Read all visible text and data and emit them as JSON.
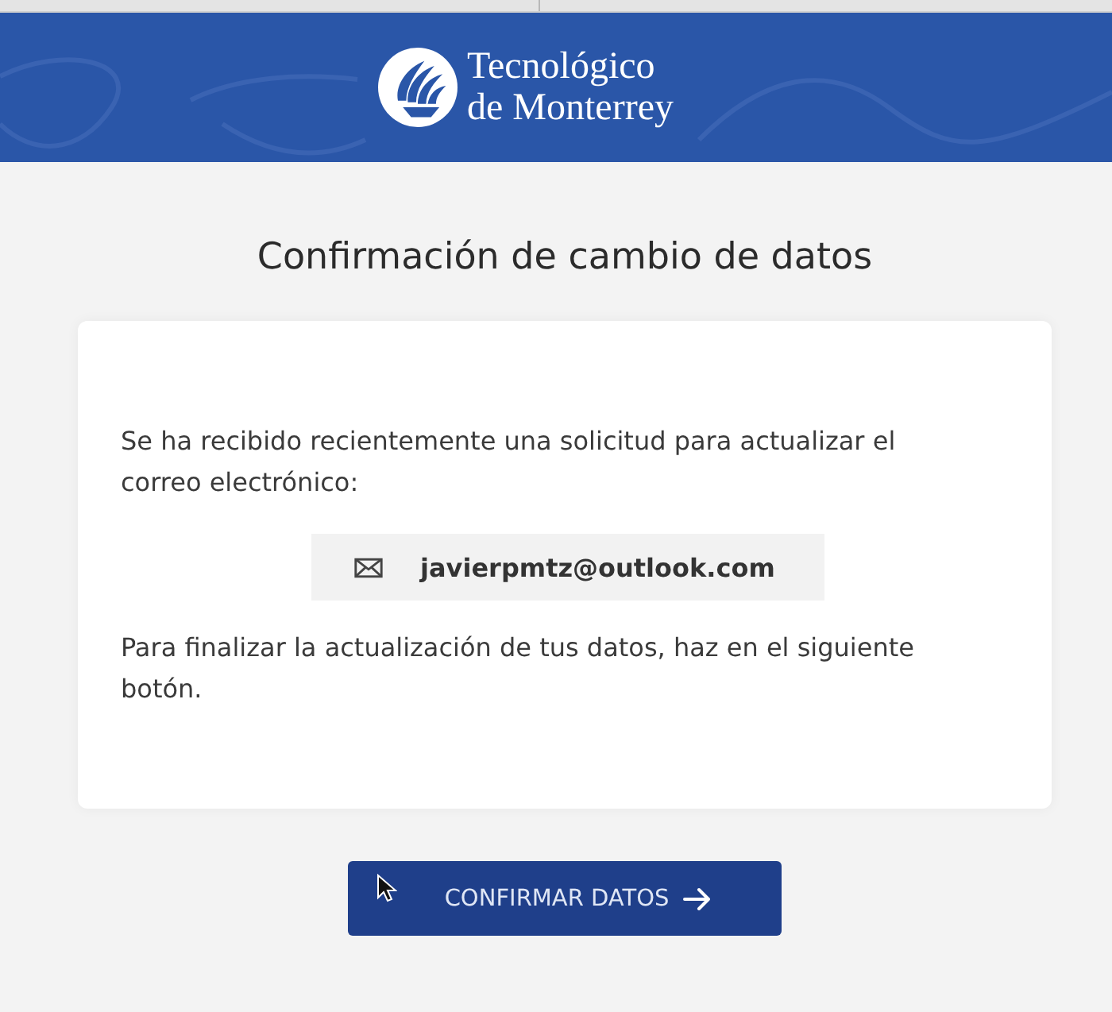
{
  "header": {
    "logo_text": [
      "Tecnológico",
      "de Monterrey"
    ]
  },
  "title": "Confirmación de cambio de datos",
  "card": {
    "intro": "Se ha recibido recientemente una solicitud para actualizar el correo electrónico:",
    "email": "javierpmtz@outlook.com",
    "instruction": "Para finalizar la actualización de tus datos, haz en el siguiente botón."
  },
  "button": {
    "label": "CONFIRMAR DATOS"
  }
}
